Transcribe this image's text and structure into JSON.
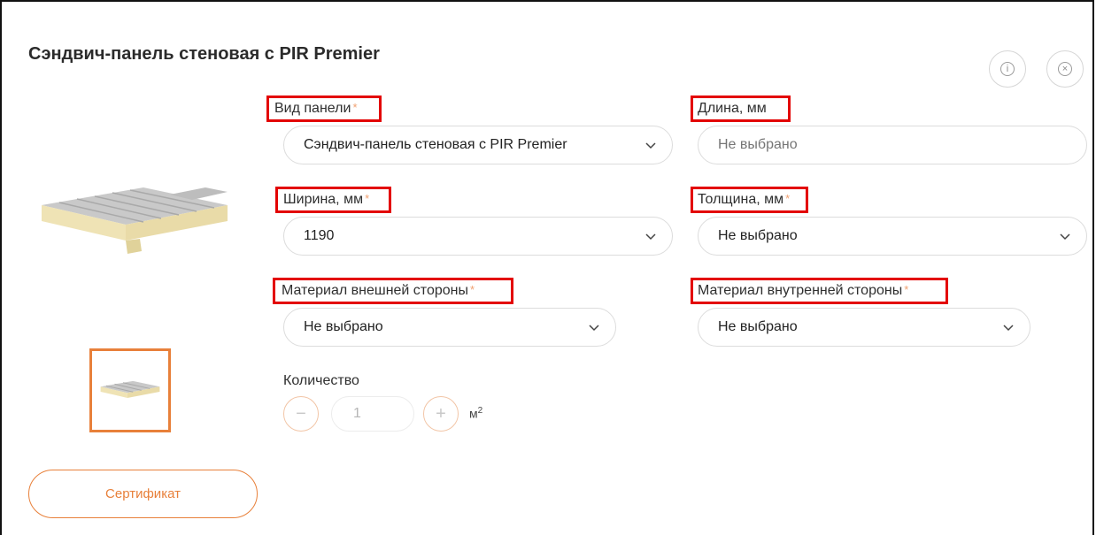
{
  "page_title": "Сэндвич-панель стеновая с PIR Premier",
  "icons": {
    "info": "info-icon",
    "close": "close-icon",
    "chevron": "chevron-down-icon"
  },
  "fields": {
    "panel_type": {
      "label": "Вид панели",
      "required": "*",
      "value": "Сэндвич-панель стеновая с PIR Premier"
    },
    "length": {
      "label": "Длина, мм",
      "placeholder": "Не выбрано"
    },
    "width": {
      "label": "Ширина, мм",
      "required": "*",
      "value": "1190"
    },
    "thickness": {
      "label": "Толщина, мм",
      "required": "*",
      "value": "Не выбрано"
    },
    "outer_material": {
      "label": "Материал внешней стороны",
      "required": "*",
      "value": "Не выбрано"
    },
    "inner_material": {
      "label": "Материал внутренней стороны",
      "required": "*",
      "value": "Не выбрано"
    }
  },
  "quantity": {
    "label": "Количество",
    "minus": "−",
    "plus": "+",
    "value": "1",
    "unit": "м",
    "unit_sup": "2"
  },
  "certificate_label": "Сертификат",
  "colors": {
    "accent": "#e8803a",
    "highlight_box": "#e30000"
  }
}
